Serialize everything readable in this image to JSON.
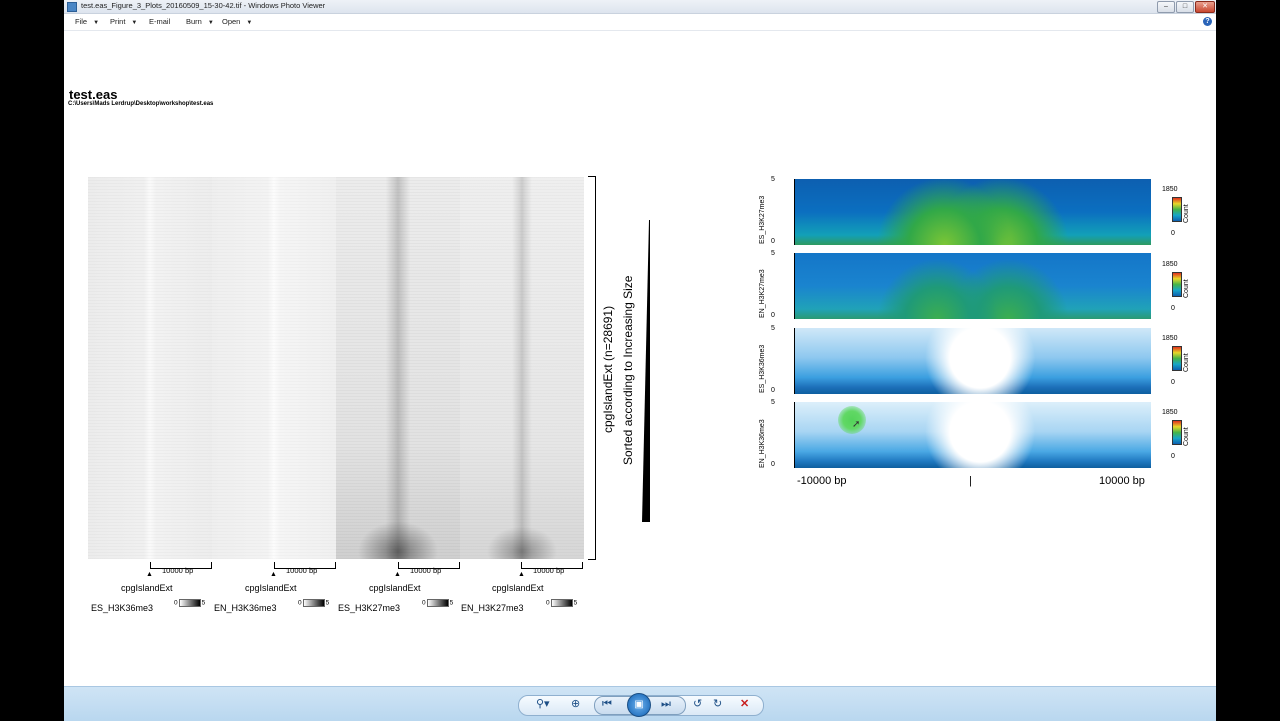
{
  "window": {
    "title": "test.eas_Figure_3_Plots_20160509_15-30-42.tif - Windows Photo Viewer",
    "controls": {
      "minimize": "–",
      "maximize": "□",
      "close": "✕"
    }
  },
  "menu": {
    "items": [
      {
        "label": "File",
        "arrow": "▼"
      },
      {
        "label": "Print",
        "arrow": "▼"
      },
      {
        "label": "E-mail",
        "arrow": ""
      },
      {
        "label": "Burn",
        "arrow": "▼"
      },
      {
        "label": "Open",
        "arrow": "▼"
      }
    ],
    "help": "?"
  },
  "document": {
    "title": "test.eas",
    "path": "C:\\Users\\Mads Lerdrup\\Desktop\\workshop\\test.eas"
  },
  "left_figure": {
    "y_label_main": "cpgIslandExt (n=28691)",
    "y_label_sort": "Sorted according to Increasing Size",
    "scale_label": "10000 bp",
    "feature_label": "cpgIslandExt",
    "marker": "▲",
    "panels": [
      {
        "name": "ES_H3K36me3",
        "legend_min": "0",
        "legend_max": "5"
      },
      {
        "name": "EN_H3K36me3",
        "legend_min": "0",
        "legend_max": "5"
      },
      {
        "name": "ES_H3K27me3",
        "legend_min": "0",
        "legend_max": "5"
      },
      {
        "name": "EN_H3K27me3",
        "legend_min": "0",
        "legend_max": "5"
      }
    ]
  },
  "right_figure": {
    "panels": [
      {
        "name": "ES_H3K27me3",
        "y_max": "5",
        "y_min": "0",
        "color_max": "1850",
        "color_min": "0",
        "color_label": "Count"
      },
      {
        "name": "EN_H3K27me3",
        "y_max": "5",
        "y_min": "0",
        "color_max": "1850",
        "color_min": "0",
        "color_label": "Count"
      },
      {
        "name": "ES_H3K36me3",
        "y_max": "5",
        "y_min": "0",
        "color_max": "1850",
        "color_min": "0",
        "color_label": "Count"
      },
      {
        "name": "EN_H3K36me3",
        "y_max": "5",
        "y_min": "0",
        "color_max": "1850",
        "color_min": "0",
        "color_label": "Count"
      }
    ],
    "x_min_label": "-10000 bp",
    "x_mid_label": "|",
    "x_max_label": "10000 bp"
  },
  "toolbar": {
    "zoom": "⚲▾",
    "fit": "⊕",
    "previous": "⏮",
    "slideshow": "▣",
    "next": "⏭",
    "rotate_ccw": "↺",
    "rotate_cw": "↻",
    "delete": "✕"
  }
}
